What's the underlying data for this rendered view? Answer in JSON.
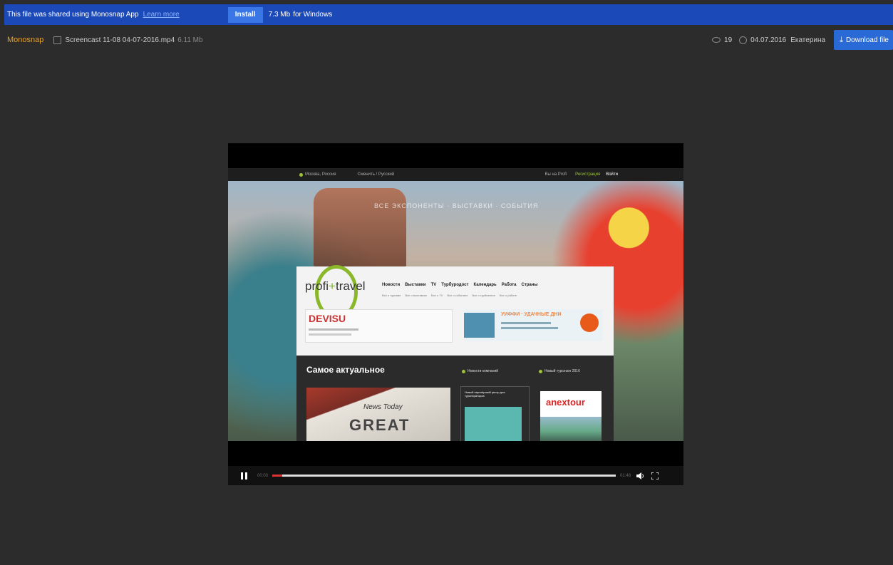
{
  "banner": {
    "message": "This file was shared using Monosnap App",
    "learn_more": "Learn more",
    "install": "Install",
    "size": "7.3 Mb",
    "platform": "for Windows"
  },
  "file": {
    "brand": "Monosnap",
    "name": "Screencast 11-08 04-07-2016.mp4",
    "size": "6.11 Mb",
    "views": "19",
    "date": "04.07.2016",
    "author": "Екатерина",
    "download": "Download file"
  },
  "video": {
    "site": {
      "location": "Москва, Россия",
      "language": "Сменить / Русский",
      "subscribe": "Вы на Profi",
      "register": "Регистрация",
      "login": "Войти",
      "tagline": "ВСЕ ЭКСПОНЕНТЫ · ВЫСТАВКИ · СОБЫТИЯ",
      "logo_left": "profi",
      "logo_right": "travel",
      "nav": [
        "Новости",
        "Выставки",
        "TV",
        "Турбуродост",
        "Календарь",
        "Работа",
        "Страны"
      ],
      "subnav": [
        "Все о туризме",
        "Все о выставках",
        "Все о TV",
        "Все о событиях",
        "Все о турбизнесе",
        "Все о работе"
      ],
      "ad1_brand": "DEVISU",
      "ad2_promo": "УИФФИ · УДАЧНЫЕ ДНИ",
      "news_title": "Самое актуальное",
      "newspaper_name": "News Today",
      "newspaper_headline": "GREAT",
      "col2_heading": "Новости компаний",
      "col2_card_text": "Новый партнёрский центр для туроператоров",
      "col3_heading": "Новый турсезон 2016",
      "anex": "anextour"
    },
    "controls": {
      "elapsed": "00:03",
      "duration": "01:48",
      "progress": 0.03
    }
  },
  "colors": {
    "banner": "#1c49b8",
    "accent": "#2a6ad6",
    "brand": "#e0a030",
    "progress": "#d33333"
  }
}
